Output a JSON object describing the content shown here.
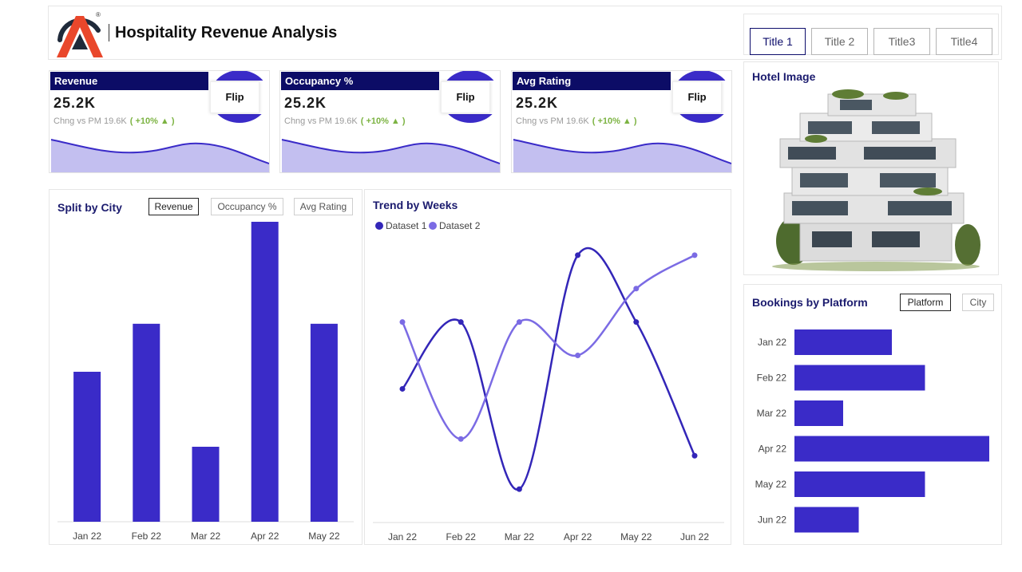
{
  "header": {
    "title": "Hospitality Revenue Analysis",
    "tabs": [
      "Title 1",
      "Title 2",
      "Title3",
      "Title4"
    ],
    "active_tab": 0,
    "logo_mark": "®"
  },
  "kpis": [
    {
      "label": "Revenue",
      "value": "25.2K",
      "compare": "Chng vs PM 19.6K",
      "change": "( +10% ▲ )",
      "flip": "Flip"
    },
    {
      "label": "Occupancy %",
      "value": "25.2K",
      "compare": "Chng vs PM 19.6K",
      "change": "( +10% ▲ )",
      "flip": "Flip"
    },
    {
      "label": "Avg Rating",
      "value": "25.2K",
      "compare": "Chng vs PM 19.6K",
      "change": "( +10% ▲ )",
      "flip": "Flip"
    }
  ],
  "hotel": {
    "title": "Hotel Image"
  },
  "split_by_city": {
    "title": "Split by City",
    "buttons": [
      "Revenue",
      "Occupancy %",
      "Avg Rating"
    ],
    "active_button": 0
  },
  "trend": {
    "title": "Trend by Weeks"
  },
  "platform": {
    "title": "Bookings by Platform",
    "buttons": [
      "Platform",
      "City"
    ],
    "active_button": 0
  },
  "colors": {
    "navy": "#0c0c66",
    "bar": "#3a2bc8",
    "series1": "#3326b8",
    "series2": "#7b6be4",
    "spark_fill": "#c3bff0",
    "spark_line": "#3a2bc8",
    "positive": "#7cb342"
  },
  "chart_data": [
    {
      "type": "bar",
      "categories": [
        "Jan 22",
        "Feb 22",
        "Mar 22",
        "Apr 22",
        "May 22"
      ],
      "values": [
        50,
        66,
        25,
        100,
        66
      ],
      "ylim": [
        0,
        100
      ]
    },
    {
      "type": "line",
      "categories": [
        "Jan 22",
        "Feb 22",
        "Mar 22",
        "Apr 22",
        "May 22",
        "Jun 22"
      ],
      "series": [
        {
          "name": "Dataset 1",
          "values": [
            60,
            80,
            30,
            100,
            80,
            40
          ]
        },
        {
          "name": "Dataset 2",
          "values": [
            80,
            45,
            80,
            70,
            90,
            100
          ]
        }
      ],
      "ylim": [
        20,
        110
      ]
    },
    {
      "type": "bar",
      "orientation": "horizontal",
      "categories": [
        "Jan 22",
        "Feb 22",
        "Mar 22",
        "Apr 22",
        "May 22",
        "Jun 22"
      ],
      "values": [
        50,
        67,
        25,
        100,
        67,
        33
      ],
      "xlim": [
        0,
        100
      ]
    }
  ]
}
